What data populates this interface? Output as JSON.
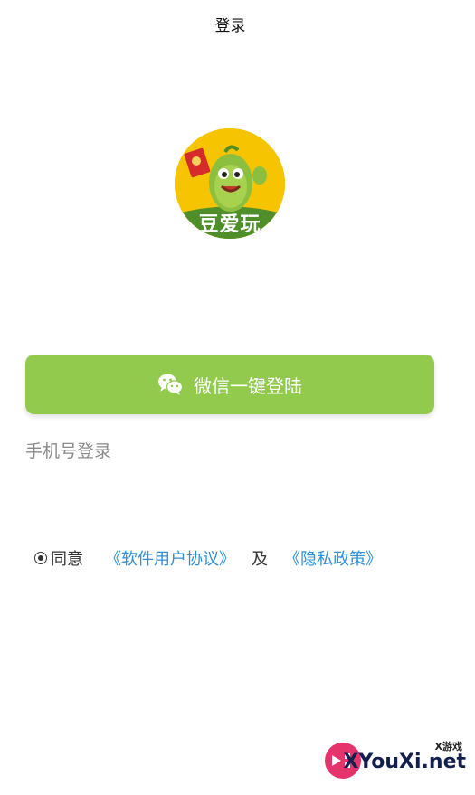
{
  "header": {
    "title": "登录"
  },
  "logo": {
    "text": "豆爱玩"
  },
  "login": {
    "wechat_label": "微信一键登陆",
    "phone_label": "手机号登录"
  },
  "agreement": {
    "agree_label": "同意",
    "user_agreement": "《软件用户协议》",
    "and_label": "及",
    "privacy_policy": "《隐私政策》"
  },
  "watermark": {
    "top_text": "X游戏",
    "main_text": "XYouXi.net"
  },
  "colors": {
    "wechat_button": "#91ca4c",
    "link": "#2f8fd6",
    "logo_bg": "#f6c400"
  }
}
